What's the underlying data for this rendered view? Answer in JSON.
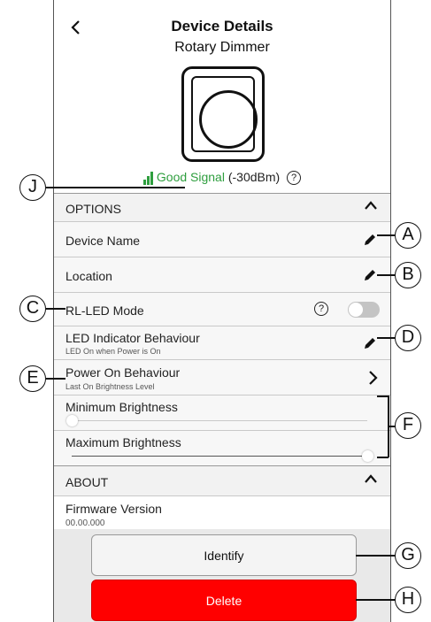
{
  "header": {
    "back_icon": "chevron-left-icon",
    "title": "Device Details",
    "subtitle": "Rotary Dimmer"
  },
  "signal": {
    "status": "Good Signal",
    "strength": "(-30dBm)",
    "help": "?",
    "color": "#2e9e3e"
  },
  "options": {
    "header": "OPTIONS",
    "device_name": {
      "label": "Device Name"
    },
    "location": {
      "label": "Location"
    },
    "rl_led_mode": {
      "label": "RL-LED Mode",
      "help": "?",
      "enabled": false
    },
    "led_indicator": {
      "label": "LED Indicator Behaviour",
      "sub": "LED On when Power is On"
    },
    "power_on": {
      "label": "Power On Behaviour",
      "sub": "Last On Brightness Level"
    },
    "min_brightness": {
      "label": "Minimum Brightness",
      "value_fraction": 0.0
    },
    "max_brightness": {
      "label": "Maximum Brightness",
      "value_fraction": 1.0
    }
  },
  "about": {
    "header": "ABOUT",
    "firmware": {
      "label": "Firmware Version",
      "value": "00.00.000"
    }
  },
  "buttons": {
    "identify": "Identify",
    "delete": "Delete",
    "delete_color": "#ff0000"
  },
  "callouts": {
    "a": "A",
    "b": "B",
    "c": "C",
    "d": "D",
    "e": "E",
    "f": "F",
    "g": "G",
    "h": "H",
    "j": "J"
  }
}
